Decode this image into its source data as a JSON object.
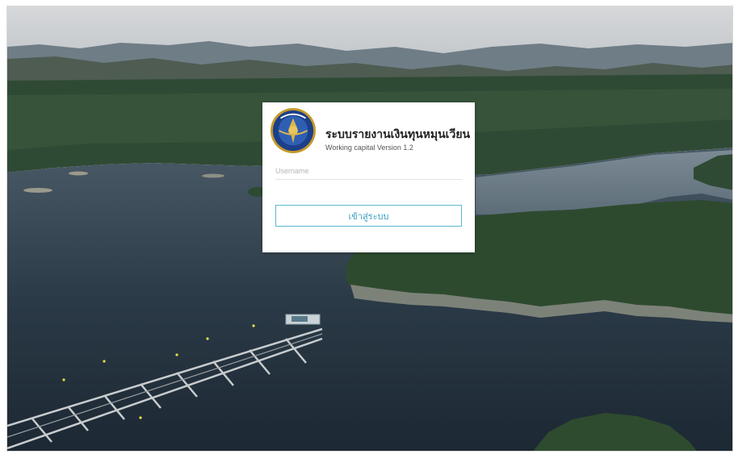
{
  "app": {
    "title": "ระบบรายงานเงินทุนหมุนเวียน",
    "subtitle": "Working capital Version 1.2",
    "logo_icon": "government-seal-icon"
  },
  "form": {
    "username_placeholder": "Username",
    "username_value": "",
    "login_label": "เข้าสู่ระบบ"
  },
  "colors": {
    "button_border": "#5bb8d4",
    "button_text": "#3a9fc0",
    "card_background": "#ffffff"
  }
}
